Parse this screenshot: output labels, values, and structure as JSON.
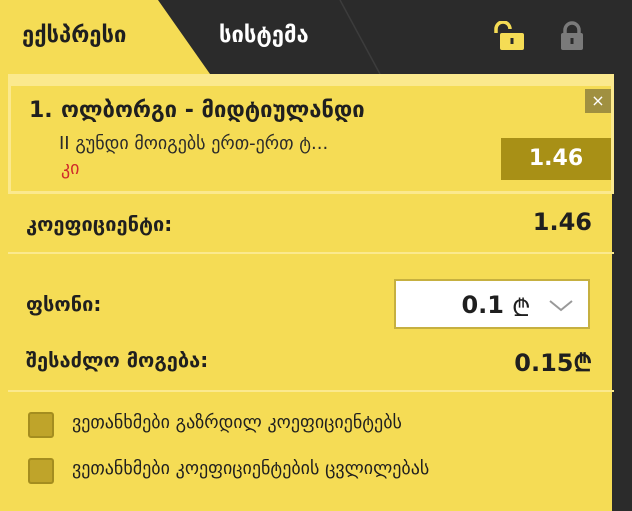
{
  "tabs": {
    "express": "ექსპრესი",
    "system": "სისტემა"
  },
  "icons": {
    "lock_open": "lock-open-icon",
    "lock_closed": "lock-icon",
    "close": "close-icon",
    "chevron": "chevron-down-icon"
  },
  "colors": {
    "panel": "#f5dc55",
    "dark": "#2b2b2b",
    "odds_box": "#a89016",
    "accent_red": "#d02a2a",
    "lock_open": "#f5dc55",
    "lock_closed": "#7a7a7a"
  },
  "bet": {
    "number": "1.",
    "title": "ოლბორგი - მიდტიულანდი",
    "market": "II გუნდი მოიგებს ერთ-ერთ ტ...",
    "pick": "კი",
    "close_symbol": "×",
    "odds": "1.46"
  },
  "summary": {
    "coefficient_label": "კოეფიციენტი:",
    "coefficient_value": "1.46",
    "stake_label": "ფსონი:",
    "stake_value": "0.1",
    "currency": "₾",
    "possible_win_label": "შესაძლო მოგება:",
    "possible_win_value": "0.15₾"
  },
  "options": [
    {
      "label": "ვეთანხმები გაზრდილ კოეფიციენტებს",
      "checked": false
    },
    {
      "label": "ვეთანხმები კოეფიციენტების ცვლილებას",
      "checked": false
    }
  ]
}
